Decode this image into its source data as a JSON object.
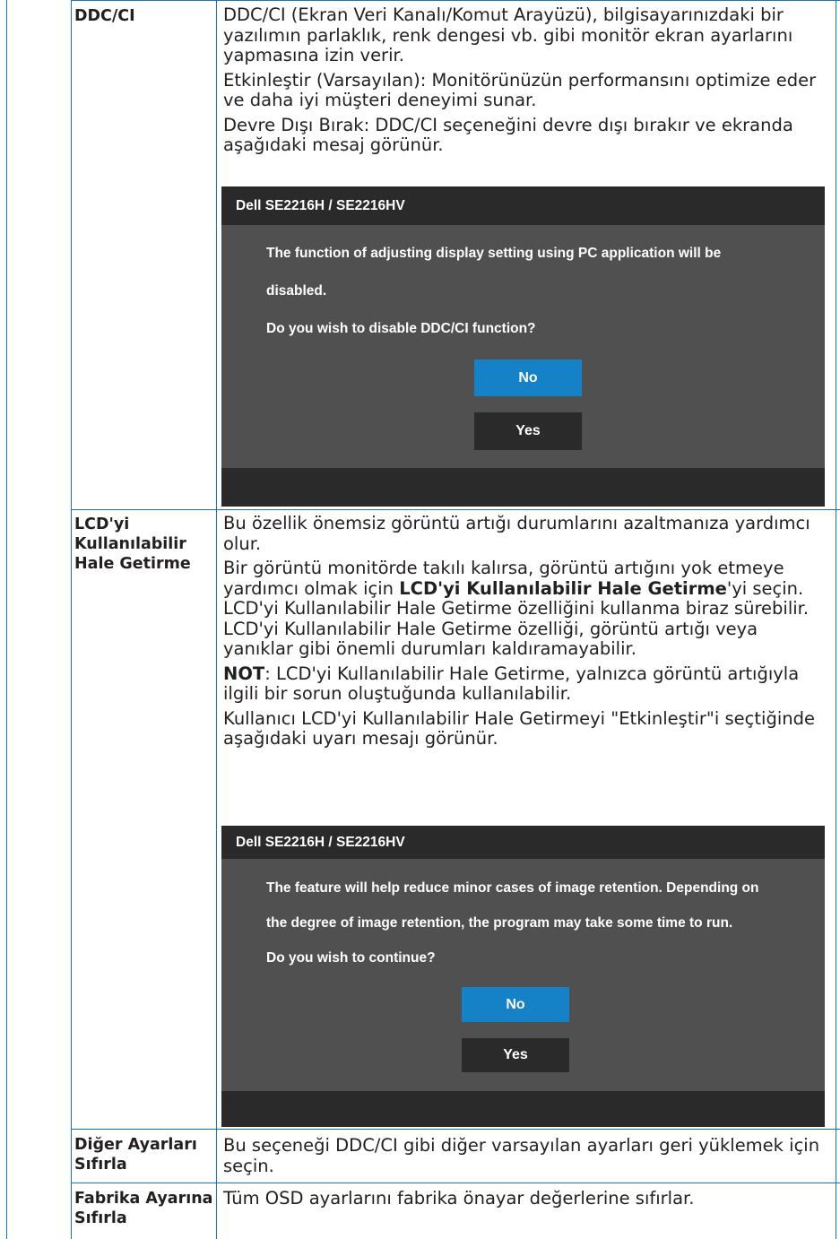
{
  "rows": [
    {
      "label": "DDC/CI",
      "paragraphs": [
        "DDC/CI (Ekran Veri Kanalı/Komut Arayüzü), bilgisayarınızdaki bir yazılımın parlaklık, renk dengesi vb. gibi monitör ekran ayarlarını yapmasına izin verir.",
        "Etkinleştir (Varsayılan): Monitörünüzün performansını optimize eder ve daha iyi müşteri deneyimi sunar.",
        "Devre Dışı Bırak: DDC/CI seçeneğini devre dışı bırakır ve ekranda aşağıdaki mesaj görünür."
      ],
      "osd": {
        "title": "Dell SE2216H / SE2216HV",
        "line1": "The function of adjusting display setting using PC application will be",
        "line2": "disabled.",
        "line3": "Do you wish to disable DDC/CI function?",
        "no": "No",
        "yes": "Yes"
      }
    },
    {
      "label_lines": [
        "LCD'yi",
        "Kullanılabilir",
        "Hale Getirme"
      ],
      "p1": "Bu özellik önemsiz görüntü artığı durumlarını azaltmanıza yardımcı olur.",
      "p2_a": "Bir görüntü monitörde takılı kalırsa, görüntü artığını yok etmeye yardımcı olmak için ",
      "p2_b": "LCD'yi Kullanılabilir Hale Getirme",
      "p2_c": "'yi seçin. LCD'yi Kullanılabilir Hale Getirme özelliğini kullanma biraz sürebilir. LCD'yi Kullanılabilir Hale Getirme özelliği, görüntü artığı veya yanıklar gibi önemli durumları kaldıramayabilir.",
      "p3_a": "NOT",
      "p3_b": ": LCD'yi Kullanılabilir Hale Getirme, yalnızca görüntü artığıyla ilgili bir sorun oluştuğunda kullanılabilir.",
      "p4": "Kullanıcı LCD'yi Kullanılabilir Hale Getirmeyi \"Etkinleştir\"i seçtiğinde aşağıdaki uyarı mesajı görünür.",
      "osd": {
        "title": "Dell SE2216H / SE2216HV",
        "line1": "The feature will help reduce minor cases of image retention. Depending on",
        "line2": "the degree of image retention, the program may take some time to run.",
        "line3": "Do you wish to continue?",
        "no": "No",
        "yes": "Yes"
      }
    },
    {
      "label_lines": [
        "Diğer Ayarları",
        "Sıfırla"
      ],
      "desc": "Bu seçeneği DDC/CI gibi diğer varsayılan ayarları geri yüklemek için seçin."
    },
    {
      "label_lines": [
        "Fabrika Ayarına",
        "Sıfırla"
      ],
      "desc": "Tüm OSD ayarlarını fabrika önayar değerlerine sıfırlar."
    }
  ]
}
